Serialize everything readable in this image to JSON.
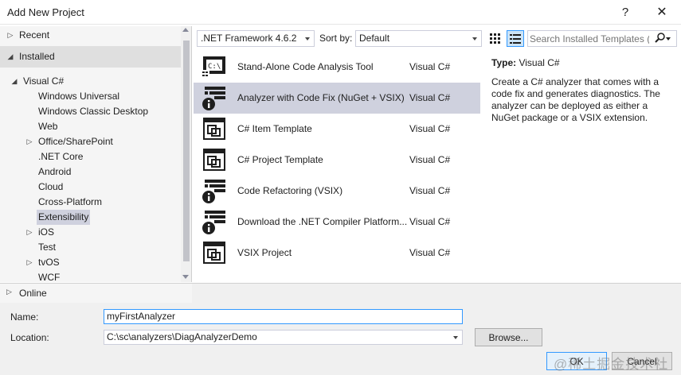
{
  "window": {
    "title": "Add New Project",
    "help_glyph": "?",
    "close_glyph": "✕"
  },
  "tree": {
    "recent": "Recent",
    "installed": "Installed",
    "visual_csharp": "Visual C#",
    "children": [
      "Windows Universal",
      "Windows Classic Desktop",
      "Web",
      "Office/SharePoint",
      ".NET Core",
      "Android",
      "Cloud",
      "Cross-Platform",
      "Extensibility",
      "iOS",
      "Test",
      "tvOS",
      "WCF"
    ],
    "selected": "Extensibility",
    "online": "Online"
  },
  "toolbar": {
    "framework": ".NET Framework 4.6.2",
    "sort_label": "Sort by:",
    "sort_value": "Default",
    "search_placeholder": "Search Installed Templates (Ctrl+E)"
  },
  "templates": [
    {
      "name": "Stand-Alone Code Analysis Tool",
      "lang": "Visual C#",
      "icon": "console-analysis-icon"
    },
    {
      "name": "Analyzer with Code Fix (NuGet + VSIX)",
      "lang": "Visual C#",
      "icon": "analyzer-info-icon",
      "selected": true
    },
    {
      "name": "C# Item Template",
      "lang": "Visual C#",
      "icon": "template-icon"
    },
    {
      "name": "C# Project Template",
      "lang": "Visual C#",
      "icon": "template-icon"
    },
    {
      "name": "Code Refactoring (VSIX)",
      "lang": "Visual C#",
      "icon": "analyzer-info-icon"
    },
    {
      "name": "Download the .NET Compiler Platform...",
      "lang": "Visual C#",
      "icon": "analyzer-info-icon"
    },
    {
      "name": "VSIX Project",
      "lang": "Visual C#",
      "icon": "template-icon"
    }
  ],
  "detail": {
    "type_label": "Type:",
    "type_value": "Visual C#",
    "description": "Create a C# analyzer that comes with a code fix and generates diagnostics. The analyzer can be deployed as either a NuGet package or a VSIX extension."
  },
  "form": {
    "name_label": "Name:",
    "name_value": "myFirstAnalyzer",
    "location_label": "Location:",
    "location_value": "C:\\sc\\analyzers\\DiagAnalyzerDemo",
    "browse": "Browse...",
    "ok": "OK",
    "cancel": "Cancel"
  },
  "watermark": "@稀土掘金技术社区",
  "colors": {
    "selection": "#cfd1de",
    "focus": "#3399ff",
    "icon": "#1e1e1e"
  }
}
